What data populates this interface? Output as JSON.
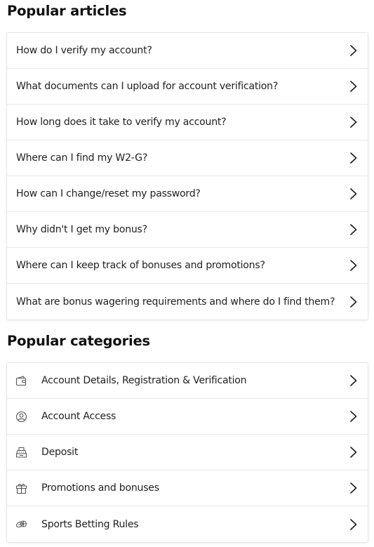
{
  "popular_articles": {
    "title": "Popular articles",
    "items": [
      {
        "label": "How do I verify my account?"
      },
      {
        "label": "What documents can I upload for account verification?"
      },
      {
        "label": "How long does it take to verify my account?"
      },
      {
        "label": "Where can I find my W2-G?"
      },
      {
        "label": "How can I change/reset my password?"
      },
      {
        "label": "Why didn't I get my bonus?"
      },
      {
        "label": "Where can I keep track of bonuses and promotions?"
      },
      {
        "label": "What are bonus wagering requirements and where do I find them?"
      }
    ]
  },
  "popular_categories": {
    "title": "Popular categories",
    "items": [
      {
        "label": "Account Details, Registration & Verification",
        "icon": "wallet-icon"
      },
      {
        "label": "Account Access",
        "icon": "user-circle-icon"
      },
      {
        "label": "Deposit",
        "icon": "cash-register-icon"
      },
      {
        "label": "Promotions and bonuses",
        "icon": "gift-icon"
      },
      {
        "label": "Sports Betting Rules",
        "icon": "sports-balls-icon"
      }
    ]
  },
  "colors": {
    "text": "#222222",
    "heading": "#111111",
    "divider": "#e8e8e8",
    "icon": "#555555"
  }
}
